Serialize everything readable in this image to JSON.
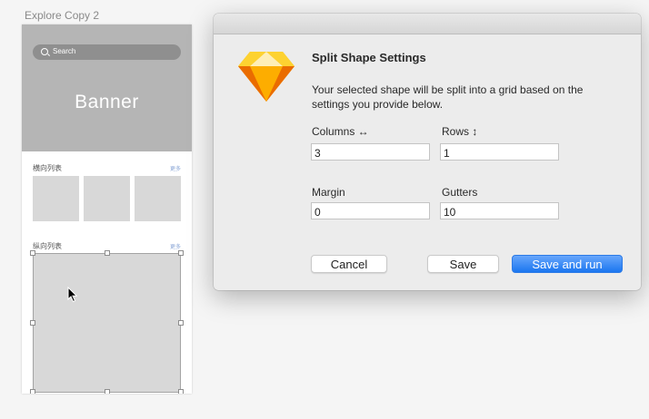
{
  "artboard": {
    "title": "Explore Copy 2",
    "search_placeholder": "Search",
    "banner_title": "Banner",
    "horizontal_section": {
      "title": "横向列表",
      "more": "更多"
    },
    "vertical_section": {
      "title": "纵向列表",
      "more": "更多"
    }
  },
  "dialog": {
    "title": "Split Shape Settings",
    "description": "Your selected shape will be split into a grid based on the settings you provide below.",
    "columns_label": "Columns ↔",
    "columns_value": "3",
    "rows_label": "Rows ↕",
    "rows_value": "1",
    "margin_label": "Margin",
    "margin_value": "0",
    "gutters_label": "Gutters",
    "gutters_value": "10",
    "cancel_label": "Cancel",
    "save_label": "Save",
    "save_run_label": "Save and run"
  },
  "icons": {
    "app": "sketch-diamond-icon",
    "cursor": "arrow-cursor-icon",
    "search": "search-icon"
  },
  "colors": {
    "primary_button": "#1b76f0",
    "sketch_orange": "#f7a11b",
    "banner_bg": "#b5b5b5"
  }
}
